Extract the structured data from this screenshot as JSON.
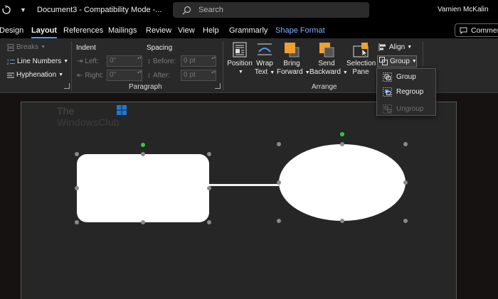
{
  "titlebar": {
    "doc_title": "Document3  -  Compatibility Mode  -...",
    "search_placeholder": "Search",
    "user_name": "Vamien McKalin"
  },
  "tabs": [
    {
      "label": "Design"
    },
    {
      "label": "Layout",
      "active": true
    },
    {
      "label": "References"
    },
    {
      "label": "Mailings"
    },
    {
      "label": "Review"
    },
    {
      "label": "View"
    },
    {
      "label": "Help"
    },
    {
      "label": "Grammarly"
    },
    {
      "label": "Shape Format",
      "contextual": true
    }
  ],
  "comments_label": "Comment",
  "ribbon": {
    "page_setup": {
      "breaks": "Breaks",
      "line_numbers": "Line Numbers",
      "hyphenation": "Hyphenation"
    },
    "paragraph": {
      "group_label": "Paragraph",
      "indent_header": "Indent",
      "spacing_header": "Spacing",
      "left_label": "Left:",
      "right_label": "Right:",
      "before_label": "Before:",
      "after_label": "After:",
      "left_value": "0\"",
      "right_value": "0\"",
      "before_value": "0 pt",
      "after_value": "0 pt"
    },
    "arrange": {
      "group_label": "Arrange",
      "position_label": "Position",
      "wrap_line1": "Wrap",
      "wrap_line2": "Text",
      "bring_line1": "Bring",
      "bring_line2": "Forward",
      "send_line1": "Send",
      "send_line2": "Backward",
      "selection_line1": "Selection",
      "selection_line2": "Pane",
      "align_label": "Align",
      "group_button_label": "Group"
    }
  },
  "group_menu": {
    "items": [
      {
        "label": "Group",
        "enabled": true
      },
      {
        "label": "Regroup",
        "enabled": true
      },
      {
        "label": "Ungroup",
        "enabled": false
      }
    ]
  },
  "watermark": {
    "line1": "The",
    "line2": "WindowsClub"
  },
  "colors": {
    "accent": "#4c9aff",
    "contextual_tab": "#7fb0ff",
    "arrange_icon_orange": "#f0a030",
    "rotation_handle": "#2ecc40"
  }
}
